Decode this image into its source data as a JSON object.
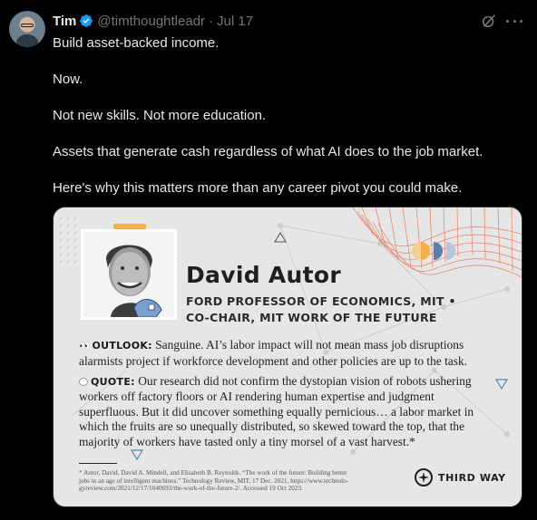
{
  "author": {
    "name": "Tim",
    "handle": "@timthoughtleadr",
    "separator": "·",
    "date": "Jul 17"
  },
  "icons": {
    "verified": "verified-badge-icon",
    "grok": "grok-icon",
    "more": "more-options-icon"
  },
  "tweet": {
    "line1": "Build asset-backed income.",
    "line2": "Now.",
    "line3": "Not new skills. Not more education.",
    "line4": "Assets that generate cash regardless of what AI does to the job market.",
    "line5": "Here's why this matters more than any career pivot you could make."
  },
  "card": {
    "person_name": "David Autor",
    "title_line1": "FORD PROFESSOR OF ECONOMICS, MIT •",
    "title_line2": "CO-CHAIR, MIT WORK OF THE FUTURE",
    "outlook_emoji": "👀",
    "outlook_label": "OUTLOOK:",
    "outlook_line1": " Sanguine. AI’s labor impact will not mean mass job disruptions",
    "outlook_line2": "alarmists project if workforce development and other policies are up to the task.",
    "quote_label": "QUOTE:",
    "quote_line1": " Our research did not confirm the dystopian vision of robots ushering",
    "quote_line2": "workers off factory floors or AI rendering human expertise and judgment",
    "quote_line3": "superfluous. But it did uncover something equally pernicious… a labor market in",
    "quote_line4": "which the fruits are so unequally distributed, so skewed toward the top, that the",
    "quote_line5": "majority of workers have tasted only a tiny morsel of a vast harvest.*",
    "footnote_line1": "* Autor, David, David A. Mindell, and Elisabeth B. Reynolds. “The work of the future: Building better",
    "footnote_line2": "jobs in an age of intelligent machines.” Technology Review, MIT, 17 Dec. 2021, https://www.technolo-",
    "footnote_line3": "gyreview.com/2021/12/17/1040693/the-work-of-the-future-2/. Accessed 19 Oct 2023.",
    "brand": "THIRD WAY"
  },
  "colors": {
    "background": "#000000",
    "text": "#e7e9ea",
    "muted": "#71767b",
    "verified_blue": "#1d9bf0",
    "card_bg": "#e6e6e6",
    "accent_orange": "#f1b04a",
    "accent_blue": "#5b7fa8",
    "mesh_red": "#e2704f"
  }
}
